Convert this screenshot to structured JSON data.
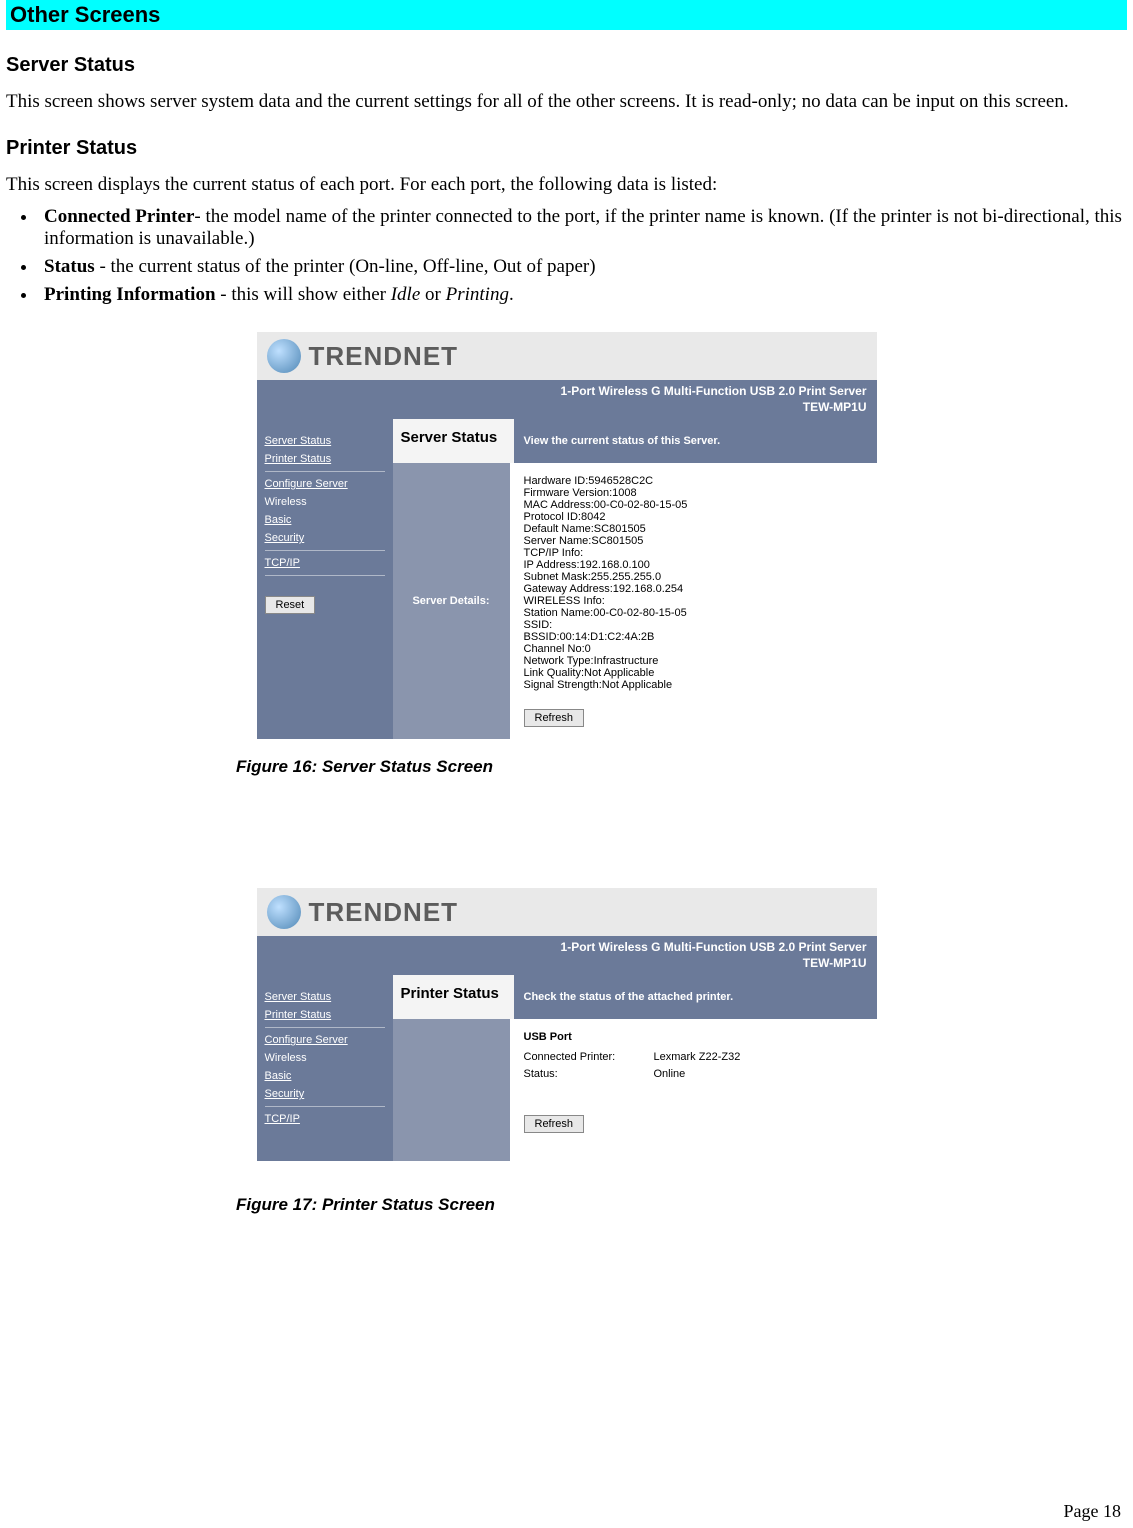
{
  "banner": "Other Screens",
  "sections": {
    "server_status_h": "Server Status",
    "server_status_p": "This screen shows server system data and the current settings for all of the other screens. It is read-only; no data can be input on this screen.",
    "printer_status_h": "Printer Status",
    "printer_status_p": "This screen displays the current status of each port. For each port, the following data is listed:",
    "bullets": {
      "b1_bold": "Connected Printer",
      "b1_rest": "- the model name of the printer connected to the port, if the printer name is known. (If the printer is not bi-directional, this information is unavailable.)",
      "b2_bold": "Status",
      "b2_rest": " - the current status of the printer (On-line, Off-line, Out of paper)",
      "b3_bold": "Printing Information",
      "b3_rest_a": " - this will show either ",
      "b3_em1": "Idle",
      "b3_rest_b": " or ",
      "b3_em2": "Printing",
      "b3_rest_c": "."
    }
  },
  "figcaps": {
    "f16": "Figure 16: Server Status Screen",
    "f17": "Figure 17: Printer Status Screen"
  },
  "shared": {
    "brand": "TRENDNET",
    "product_line1": "1-Port Wireless G Multi-Function USB 2.0 Print Server",
    "product_line2": "TEW-MP1U",
    "nav": {
      "server_status": "Server Status",
      "printer_status": "Printer Status",
      "configure": "Configure Server",
      "wireless": "Wireless",
      "basic": "Basic",
      "security": "Security",
      "tcpip": "TCP/IP",
      "reset": "Reset"
    },
    "refresh": "Refresh"
  },
  "fig16": {
    "title": "Server Status",
    "desc": "View the current status of this Server.",
    "colhead": "Server Details:",
    "lines": [
      "Hardware ID:5946528C2C",
      "Firmware Version:1008",
      "MAC Address:00-C0-02-80-15-05",
      "Protocol ID:8042",
      "Default Name:SC801505",
      "Server Name:SC801505",
      "TCP/IP Info:",
      "IP Address:192.168.0.100",
      "Subnet Mask:255.255.255.0",
      "Gateway Address:192.168.0.254",
      "WIRELESS Info:",
      "Station Name:00-C0-02-80-15-05",
      "SSID:",
      "BSSID:00:14:D1:C2:4A:2B",
      "Channel No:0",
      "Network Type:Infrastructure",
      "Link Quality:Not Applicable",
      "Signal Strength:Not Applicable"
    ]
  },
  "fig17": {
    "title": "Printer Status",
    "desc": "Check the status of the attached printer.",
    "usb_h": "USB Port",
    "rows": {
      "r1k": "Connected Printer:",
      "r1v": "Lexmark Z22-Z32",
      "r2k": "Status:",
      "r2v": "Online"
    }
  },
  "page_number": "Page 18"
}
